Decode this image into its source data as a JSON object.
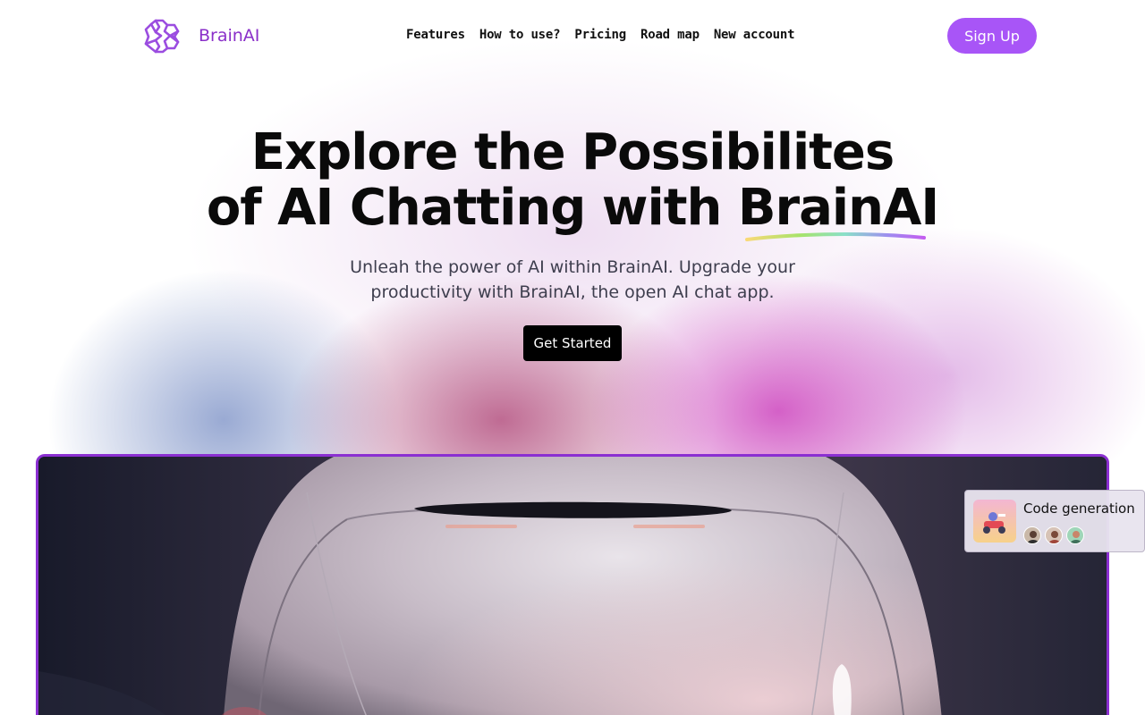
{
  "brand": {
    "name": "BrainAI",
    "icon": "brain-network-icon",
    "color": "#8a2fc9"
  },
  "nav": {
    "items": [
      "Features",
      "How to use?",
      "Pricing",
      "Road map",
      "New account"
    ],
    "signup_label": "Sign Up"
  },
  "hero": {
    "headline_line1": "Explore the Possibilites",
    "headline_line2_prefix": "of AI Chatting with ",
    "headline_highlight": "BrainAI",
    "subtitle": "Unleah the power of AI within BrainAI. Upgrade your productivity with BrainAI, the open AI chat app.",
    "cta_label": "Get Started"
  },
  "showcase": {
    "image": "robot-head-image",
    "card": {
      "title": "Code generation",
      "thumbnail": "kart-illustration",
      "avatars": [
        "user-1",
        "user-2",
        "user-3"
      ]
    }
  },
  "colors": {
    "accent": "#a855f7",
    "frame_border": "#8b2fd1",
    "cta": "#000000"
  }
}
